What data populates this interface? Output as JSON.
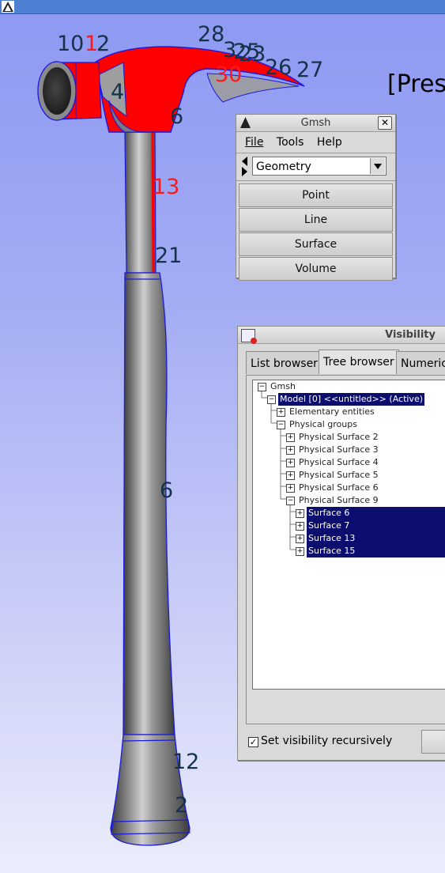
{
  "viewport": {
    "status_message": "[Pres",
    "entity_labels": {
      "l10": "10",
      "l1": "1",
      "l2": "2",
      "l28": "28",
      "l3": "3",
      "l25": "25",
      "l23": "23",
      "l26": "26",
      "l27": "27",
      "l30": "30",
      "l4": "4",
      "l6": "6",
      "l13": "13",
      "l21": "21",
      "l12": "12"
    },
    "colors": {
      "selected": "#ff0000",
      "outline": "#1a1ae0",
      "label_dark": "#16324a",
      "label_selected": "#ff1a1a"
    }
  },
  "gmsh_window": {
    "title": "Gmsh",
    "close_glyph": "✕",
    "menu": {
      "file": "File",
      "tools": "Tools",
      "help": "Help"
    },
    "module": "Geometry",
    "buttons": {
      "point": "Point",
      "line": "Line",
      "surface": "Surface",
      "volume": "Volume"
    }
  },
  "visibility_window": {
    "title": "Visibility",
    "tabs": {
      "list": "List browser",
      "tree": "Tree browser",
      "numeric": "Numeric"
    },
    "tree": {
      "gmsh": "Gmsh",
      "model": "Model [0] <<untitled>> (Active)",
      "elementary": "Elementary entities",
      "physical_groups": "Physical groups",
      "ps2": "Physical Surface 2",
      "ps3": "Physical Surface 3",
      "ps4": "Physical Surface 4",
      "ps5": "Physical Surface 5",
      "ps6": "Physical Surface 6",
      "ps9": "Physical Surface 9",
      "s6": "Surface 6",
      "s7": "Surface 7",
      "s13": "Surface 13",
      "s15": "Surface 15"
    },
    "recursive_label": "Set visibility recursively",
    "recursive_checked_glyph": "✓"
  }
}
